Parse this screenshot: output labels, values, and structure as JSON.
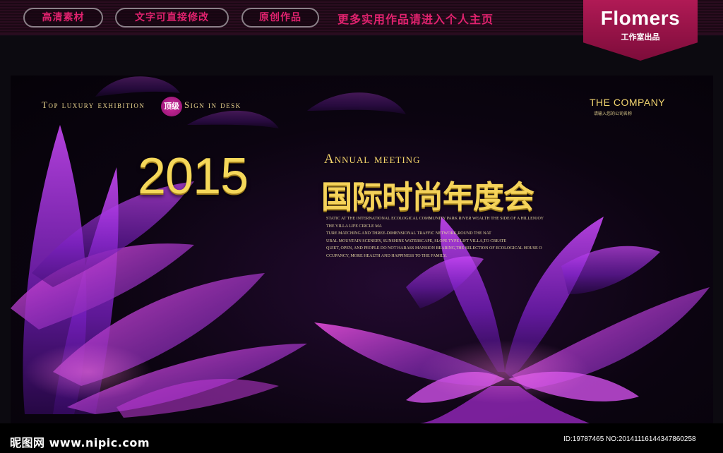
{
  "header": {
    "pills": [
      "高清素材",
      "文字可直接修改",
      "原创作品"
    ],
    "promo": "更多实用作品请进入个人主页",
    "brand_name": "Flomers",
    "brand_sub": "工作室出品"
  },
  "poster": {
    "tagline_left": "Top luxury exhibition",
    "badge": "顶级",
    "tagline_right": "Sign in desk",
    "company": "THE COMPANY",
    "company_sub": "请输入您的公司名称",
    "year": "2015",
    "annual": "Annual meeting",
    "title_cn": "国际时尚年度会",
    "description": [
      "STATIC AT THE INTERNATIONAL ECOLOGICAL COMMUNITY PARK RIVER WEALTH THE SIDE OF A HILLENJOY",
      "THE VILLA LIFE CIRCLE MA",
      "TURE MATCHING AND THREE-DIMENSIONAL TRAFFIC NETWORK,ROUND THE NAT",
      "URAL MOUNTAIN SCENERY, SUNSHINE WATERSCAPE, SLOPE TYPE LIFT VILLA,TO CREATE",
      "QUIET, OPEN, AND PEOPLE DO NOT HARASS MANSION BEARING,THE SELECTION OF ECOLOGICAL HOUSE O",
      "CCUPANCY, MORE HEALTH AND HAPPINESS TO THE FAMILY."
    ]
  },
  "footer": {
    "watermark": "昵图网 www.nipic.com",
    "id_line": "ID:19787465 NO:20141116144347860258"
  },
  "colors": {
    "accent_pink": "#e0226e",
    "gold": "#f5d85a",
    "brand_bg": "#b01a55"
  }
}
